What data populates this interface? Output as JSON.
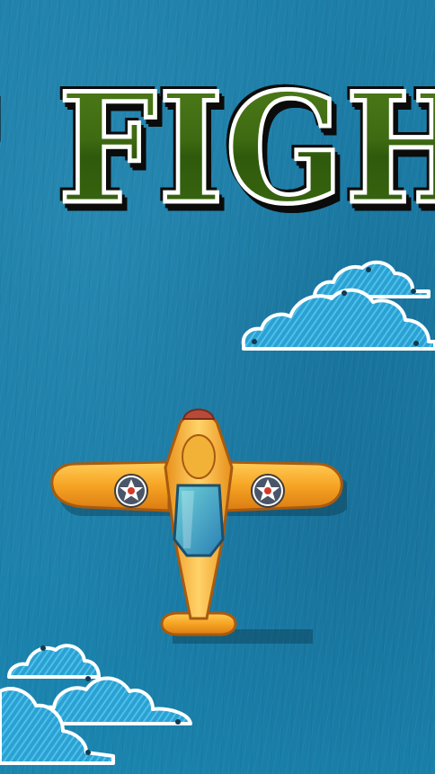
{
  "game": {
    "title_fragment": "' FIGHT"
  },
  "colors": {
    "background": "#1d7ea8",
    "title_green": "#3f6d12",
    "title_outline": "#ffffff",
    "cloud_fill": "#2ea3d4",
    "cloud_outline": "#ffffff",
    "plane_body": "#f4a024",
    "plane_canopy": "#3aa6b8",
    "roundel_star": "#ffffff",
    "roundel_center": "#d23b2b"
  },
  "icons": {
    "plane": "fighter-plane-icon",
    "cloud": "cloud-icon",
    "roundel": "star-roundel-icon"
  }
}
